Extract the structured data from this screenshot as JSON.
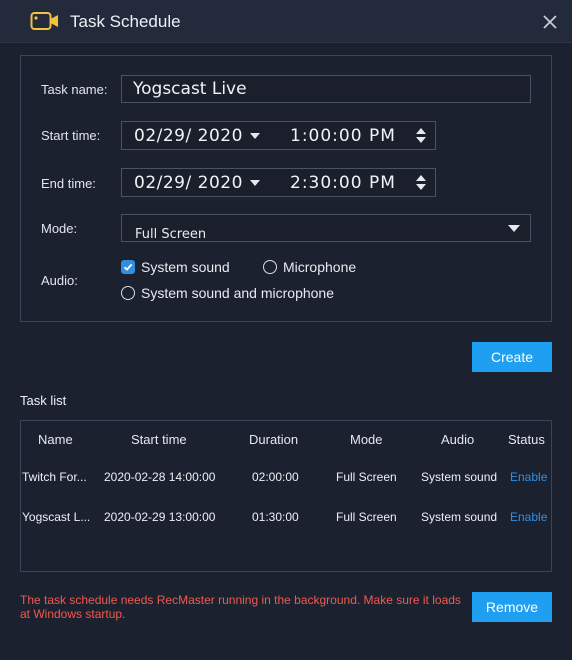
{
  "window": {
    "title": "Task Schedule",
    "icon": "video-camera-icon",
    "close_icon": "close-icon"
  },
  "form": {
    "task_name_label": "Task name:",
    "task_name_value": "Yogscast Live",
    "start_time_label": "Start time:",
    "start_date": "02/29/ 2020",
    "start_time": "1:00:00  PM",
    "end_time_label": "End time:",
    "end_date": "02/29/ 2020",
    "end_time": "2:30:00  PM",
    "mode_label": "Mode:",
    "mode_value": "Full Screen",
    "audio_label": "Audio:",
    "audio_options": [
      {
        "label": "System sound",
        "checked": true,
        "type": "checkbox"
      },
      {
        "label": "Microphone",
        "checked": false,
        "type": "radio"
      },
      {
        "label": "System sound and microphone",
        "checked": false,
        "type": "radio"
      }
    ],
    "create_label": "Create"
  },
  "task_list": {
    "title": "Task list",
    "columns": [
      "Name",
      "Start time",
      "Duration",
      "Mode",
      "Audio",
      "Status"
    ],
    "rows": [
      {
        "name": "Twitch For...",
        "start": "2020-02-28 14:00:00",
        "duration": "02:00:00",
        "mode": "Full Screen",
        "audio": "System sound",
        "status": "Enable"
      },
      {
        "name": "Yogscast L...",
        "start": "2020-02-29 13:00:00",
        "duration": "01:30:00",
        "mode": "Full Screen",
        "audio": "System sound",
        "status": "Enable"
      }
    ]
  },
  "footer": {
    "warning": "The task schedule needs RecMaster running in the background. Make sure it loads at Windows startup.",
    "remove_label": "Remove"
  },
  "colors": {
    "background": "#1c2130",
    "accent": "#1f9ff2",
    "link": "#2f8fe6",
    "warning": "#f05a4e"
  }
}
